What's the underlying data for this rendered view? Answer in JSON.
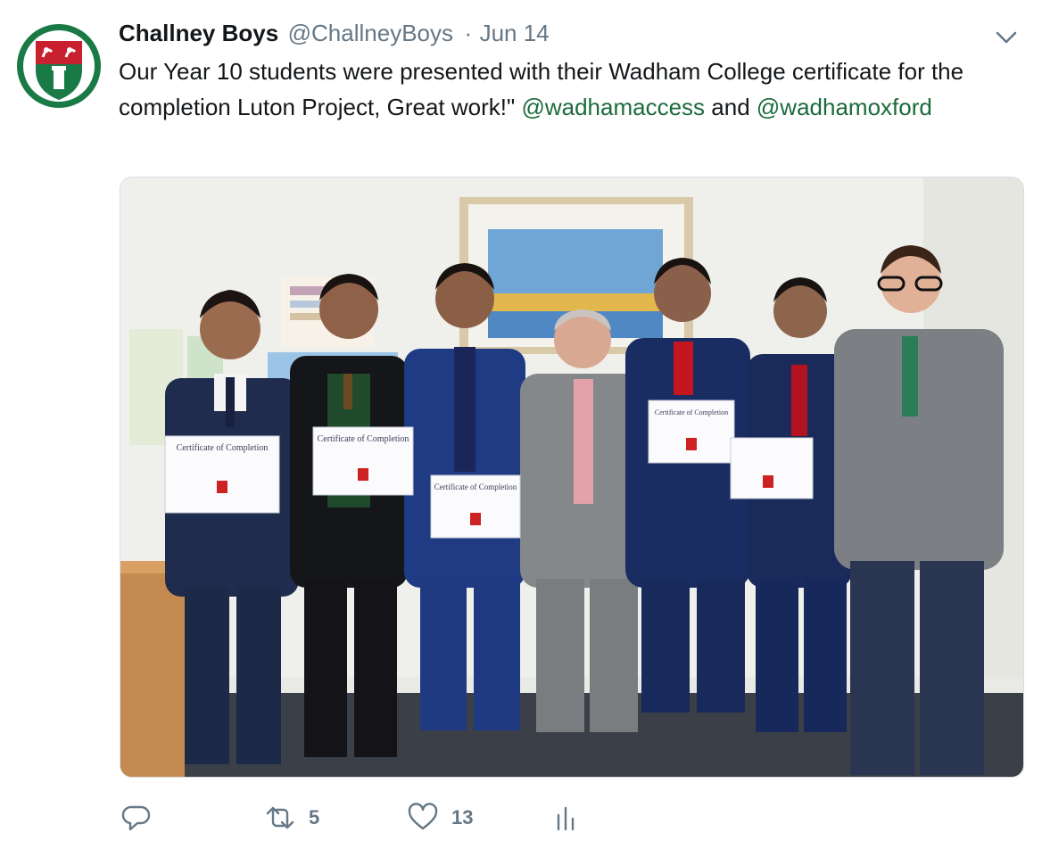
{
  "tweet": {
    "author": {
      "name": "Challney Boys",
      "handle": "@ChallneyBoys",
      "avatar_icon": "school-crest-icon"
    },
    "separator": "·",
    "date": "Jun 14",
    "text_main": "Our Year 10 students were presented with their Wadham College certificate for the completion Luton Project, Great work!\"",
    "mention_1": "@wadhamaccess",
    "conjunction": "and",
    "mention_2": "@wadhamoxford",
    "link_color": "#1b6b3a",
    "media": {
      "certificate_title": "Certificate of Completion"
    },
    "actions": {
      "reply_icon": "reply-icon",
      "retweet_icon": "retweet-icon",
      "retweet_count": "5",
      "like_icon": "heart-icon",
      "like_count": "13",
      "analytics_icon": "analytics-icon"
    }
  }
}
